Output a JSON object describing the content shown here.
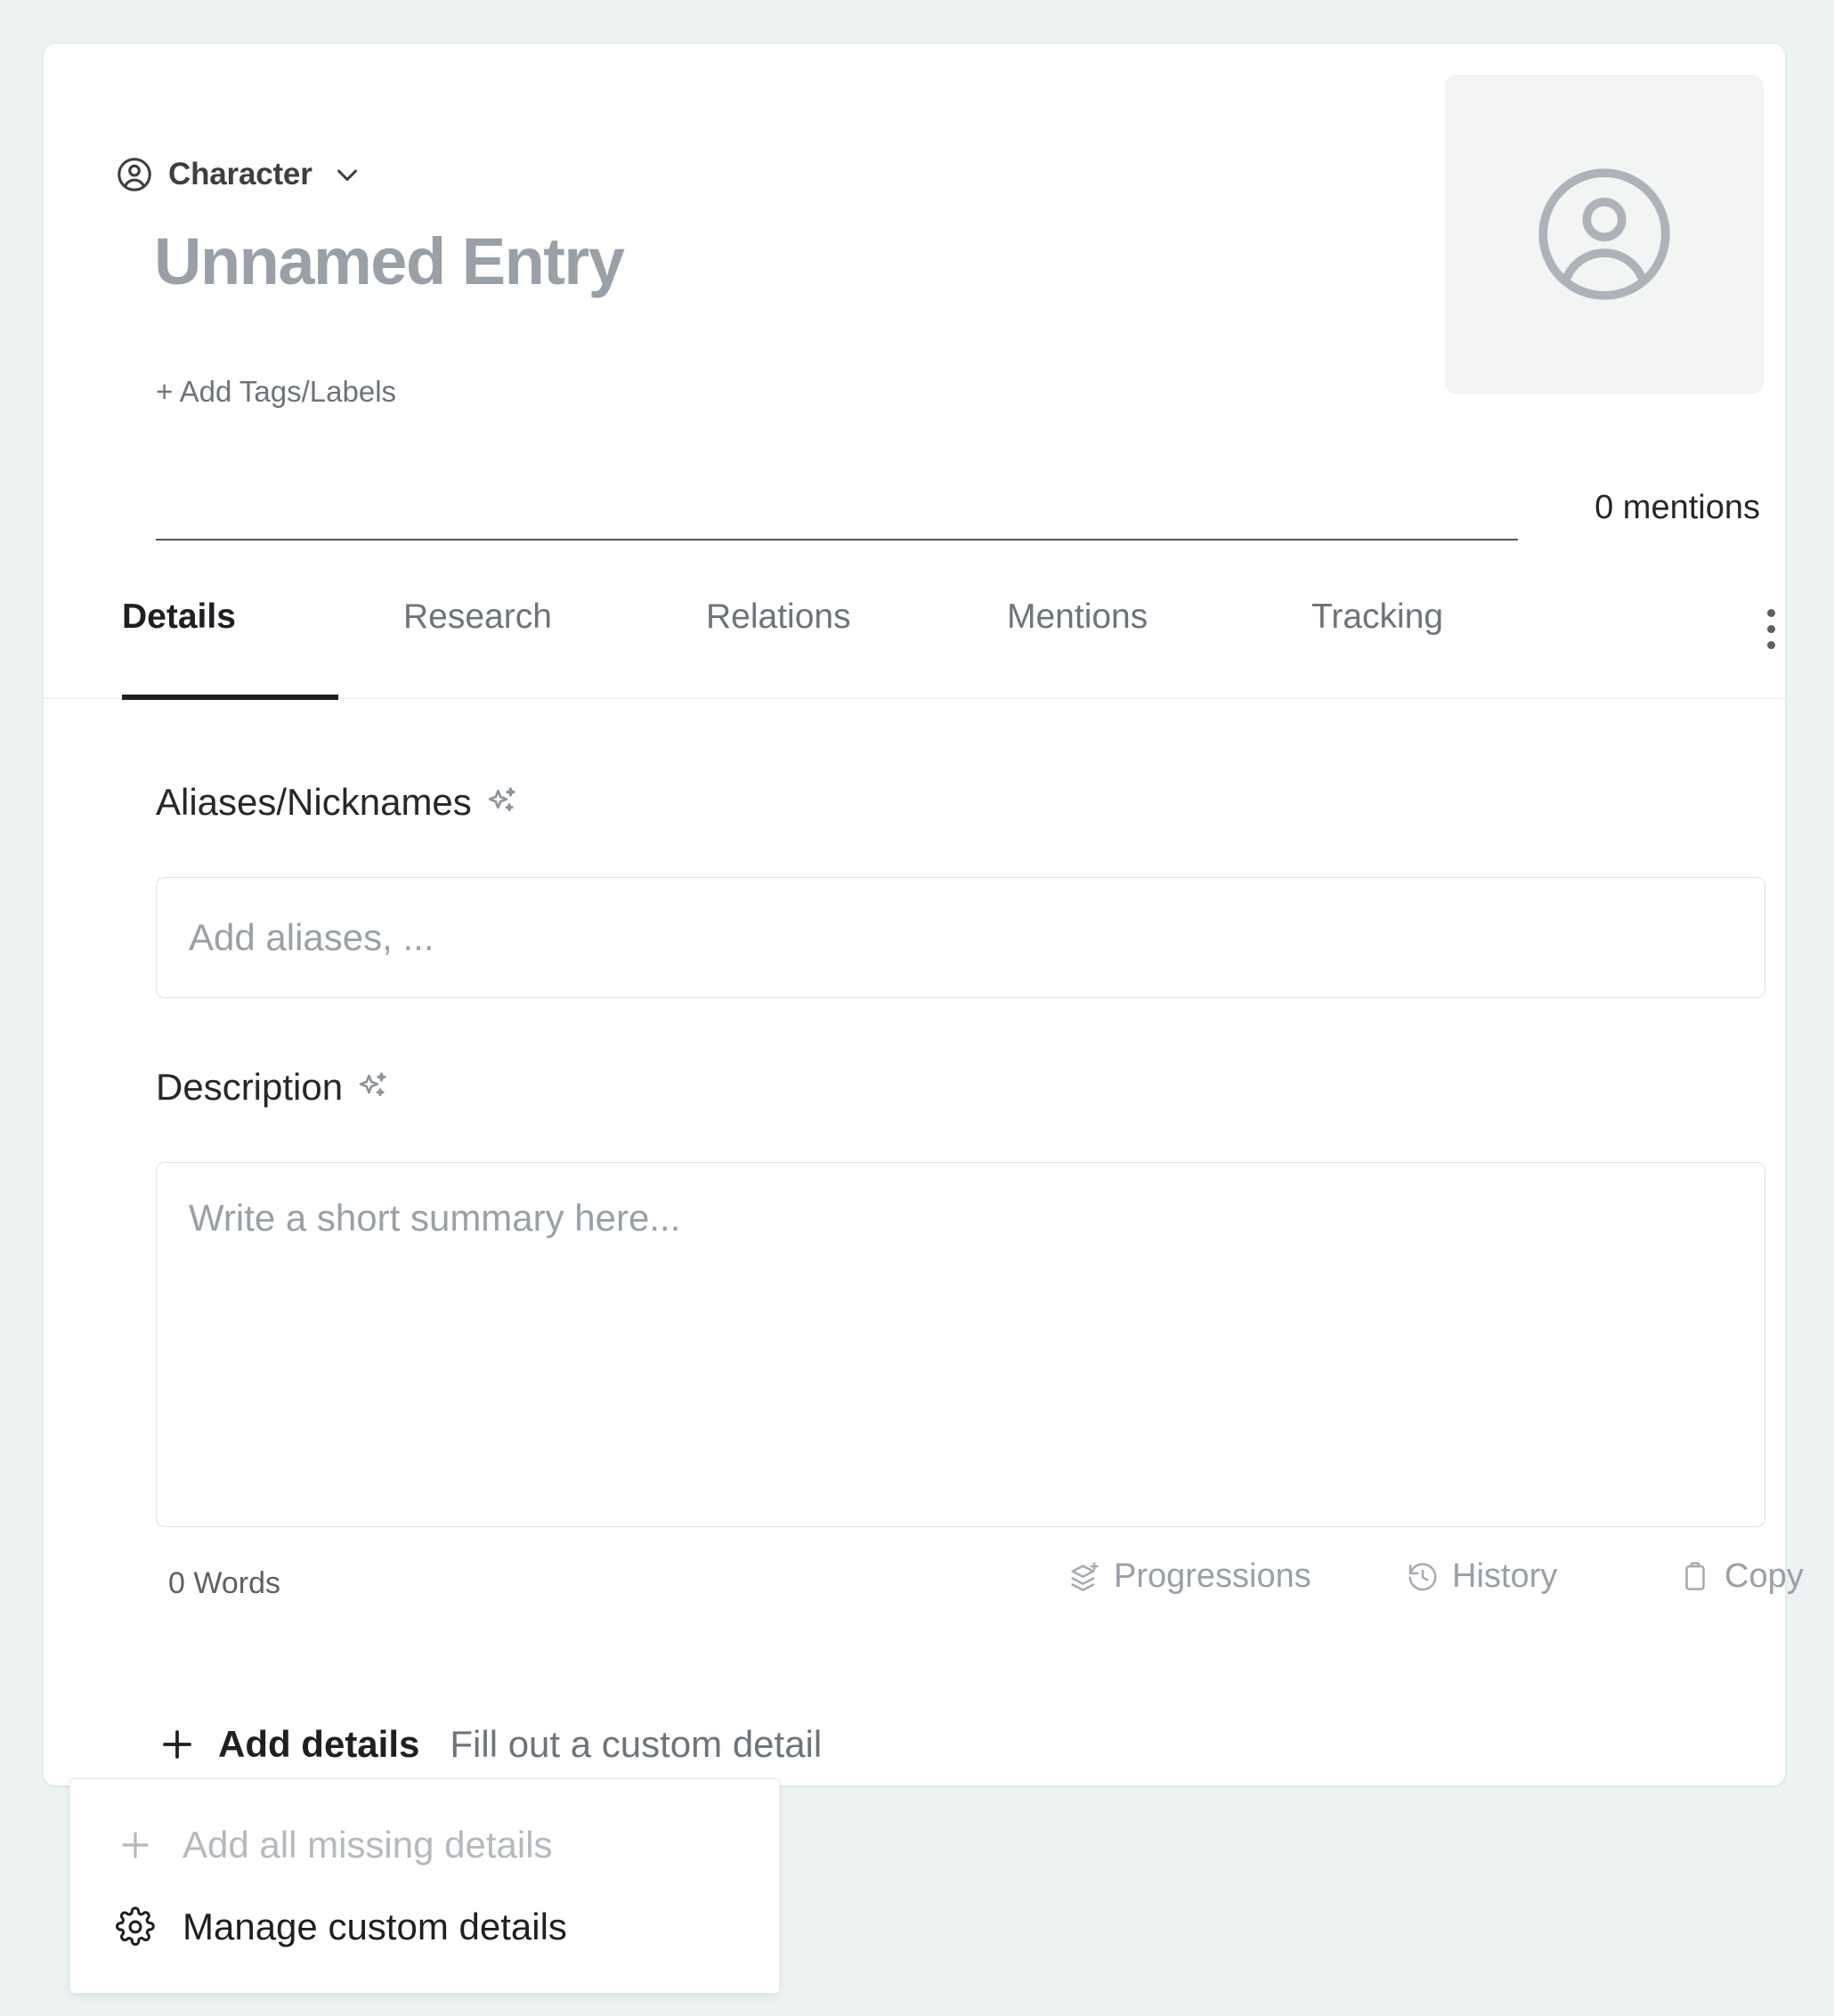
{
  "entry": {
    "type_label": "Character",
    "type_icon": "user-circle-icon",
    "chevron_icon": "chevron-down-icon",
    "title": "Unnamed Entry",
    "add_tags_label": "+ Add Tags/Labels",
    "avatar_icon": "user-circle-placeholder-icon",
    "mentions_count": "0 mentions"
  },
  "tabs": {
    "items": [
      {
        "label": "Details",
        "active": true
      },
      {
        "label": "Research",
        "active": false
      },
      {
        "label": "Relations",
        "active": false
      },
      {
        "label": "Mentions",
        "active": false
      },
      {
        "label": "Tracking",
        "active": false
      }
    ],
    "more_icon": "more-vertical-icon"
  },
  "details": {
    "aliases": {
      "label": "Aliases/Nicknames",
      "ai_icon": "sparkles-icon",
      "placeholder": "Add aliases, ...",
      "value": ""
    },
    "description": {
      "label": "Description",
      "ai_icon": "sparkles-icon",
      "placeholder": "Write a short summary here...",
      "value": ""
    },
    "toolbar": {
      "word_count": "0 Words",
      "progressions_label": "Progressions",
      "progressions_icon": "layers-plus-icon",
      "history_label": "History",
      "history_icon": "clock-rewind-icon",
      "copy_label": "Copy",
      "copy_icon": "clipboard-icon"
    },
    "add_details": {
      "plus_icon": "plus-icon",
      "label": "Add details",
      "hint": "Fill out a custom detail"
    }
  },
  "dropdown": {
    "items": [
      {
        "label": "Add all missing details",
        "icon": "plus-icon",
        "disabled": true
      },
      {
        "label": "Manage custom details",
        "icon": "gear-icon",
        "disabled": false
      }
    ]
  },
  "colors": {
    "page_background": "#edf2f2",
    "card_background": "#ffffff",
    "title_gray": "#9aa0a8",
    "text_dark": "#1d2023",
    "text_muted": "#6e747b",
    "border": "#dfe3e3"
  }
}
